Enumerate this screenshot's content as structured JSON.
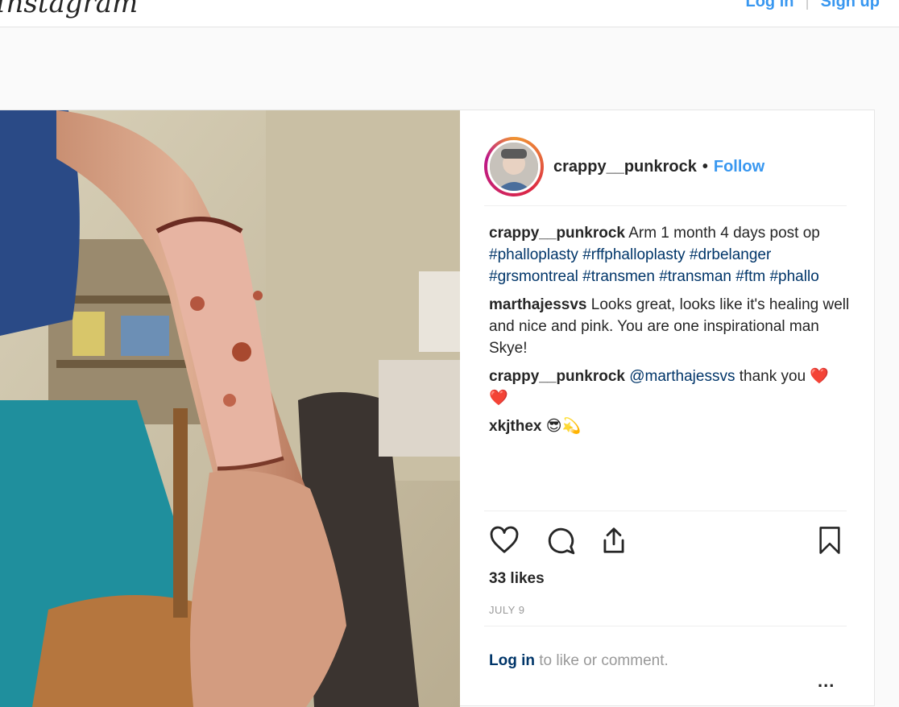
{
  "header": {
    "logo_text": "Instagram",
    "login_label": "Log in",
    "signup_label": "Sign up",
    "separator": "|"
  },
  "post": {
    "username": "crappy__punkrock",
    "follow_label": "Follow",
    "dot": "•",
    "comments": [
      {
        "user": "crappy__punkrock",
        "text": "Arm 1 month 4 days post op",
        "hashtags": "#phalloplasty #rffphalloplasty #drbelanger #grsmontreal #transmen #transman #ftm #phallo"
      },
      {
        "user": "marthajessvs",
        "text": "Looks great, looks like it's healing well and nice and pink. You are one inspirational man Skye!"
      },
      {
        "user": "crappy__punkrock",
        "mention": "@marthajessvs",
        "text": "thank you ❤️ ❤️"
      },
      {
        "user": "xkjthex",
        "text": "😎💫"
      }
    ],
    "likes": "33 likes",
    "date": "JULY 9",
    "login_prompt_link": "Log in",
    "login_prompt_text": "to like or comment.",
    "more_label": "..."
  },
  "icons": {
    "like": "heart-icon",
    "comment": "comment-bubble-icon",
    "share": "share-icon",
    "save": "bookmark-icon",
    "more": "ellipsis-icon"
  },
  "colors": {
    "link_blue": "#3897f0",
    "hashtag_navy": "#003569",
    "text": "#262626",
    "muted": "#999999",
    "border": "#efefef"
  }
}
